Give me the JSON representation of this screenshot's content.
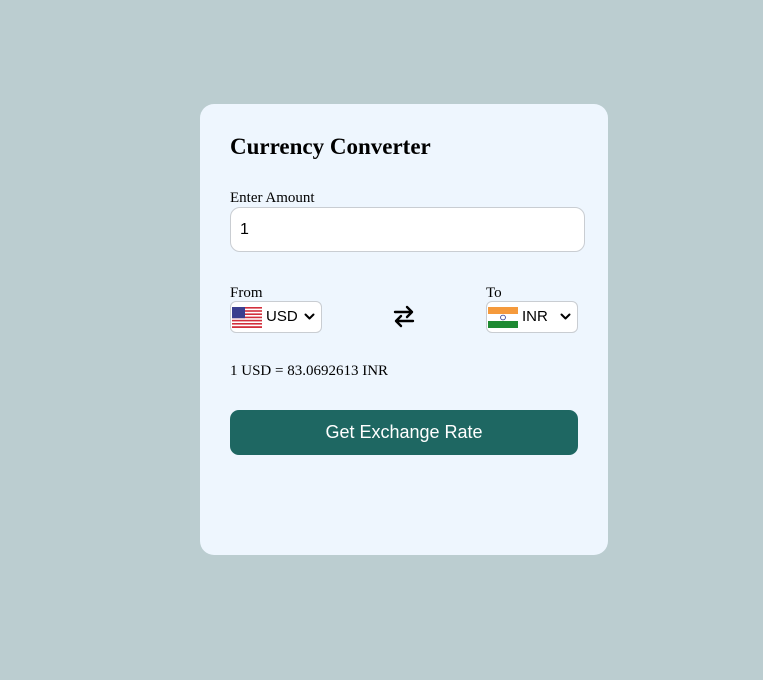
{
  "converter": {
    "title": "Currency Converter",
    "amount_label": "Enter Amount",
    "amount_value": "1",
    "from_label": "From",
    "to_label": "To",
    "from_currency": "USD",
    "to_currency": "INR",
    "from_flag_icon": "us-flag-icon",
    "to_flag_icon": "india-flag-icon",
    "swap_icon": "swap-arrows-icon",
    "rate_text": "1 USD = 83.0692613 INR",
    "button_label": "Get Exchange Rate"
  },
  "colors": {
    "page_background": "#bbcdd0",
    "card_background": "#eef6fe",
    "button_background": "#1e6762",
    "button_text": "#ffffff"
  }
}
